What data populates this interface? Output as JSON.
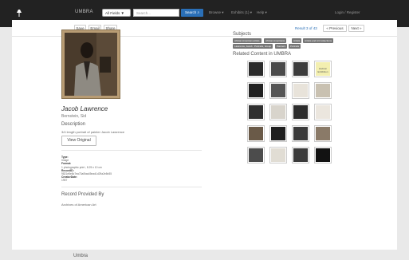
{
  "nav": {
    "brand": "UMBRA",
    "scope_select": "All Fields ▼",
    "search_placeholder": "Search...",
    "search_button": "Search",
    "browse": "Browse ▾",
    "exhibits": "Exhibits (1) ▾",
    "help": "Help ▾",
    "login": "Login / Register"
  },
  "toolbar": {
    "save": "Save",
    "email": "Email",
    "share": "Share",
    "result": "Result 3 of 43",
    "previous": "« Previous",
    "next": "Next »"
  },
  "item": {
    "title": "Jacob Lawrence",
    "creator": "Bernstein, Sid",
    "description_label": "Description",
    "description": "3/4 length portrait of painter Jacob Lawrence",
    "view_original": "View Original",
    "meta": [
      {
        "label": "Type:",
        "value": "Image"
      },
      {
        "label": "Format:",
        "value": "1 photographic print ; 8.25 x 10 cm"
      },
      {
        "label": "RecordID:",
        "value": "9821e5e8c7ea73a0faa45ead1d29a2e8e35"
      },
      {
        "label": "CreatorDate:",
        "value": "1957"
      }
    ],
    "provided_label": "Record Provided By",
    "provided_by": "Archives of American Art"
  },
  "subjects": {
    "label": "Subjects",
    "tags": [
      "African American artists",
      "African Americans",
      "Artists",
      "Artists and Art Collections",
      "Lawrence, Jacob",
      "Portraits, Group",
      "Painters",
      "Portraits"
    ]
  },
  "related": {
    "label": "Related Content in UMBRA",
    "thumbs": [
      {
        "tone": "#2b2b2b",
        "text": ""
      },
      {
        "tone": "#4a4a4a",
        "text": ""
      },
      {
        "tone": "#3c3c3c",
        "text": ""
      },
      {
        "tone": "#f3efb0",
        "text": "Hodson Exhibition"
      },
      {
        "tone": "#222222",
        "text": ""
      },
      {
        "tone": "#555555",
        "text": ""
      },
      {
        "tone": "#e8e3da",
        "text": ""
      },
      {
        "tone": "#c9c1b1",
        "text": ""
      },
      {
        "tone": "#2f2f2f",
        "text": ""
      },
      {
        "tone": "#d8d4cc",
        "text": ""
      },
      {
        "tone": "#2c2c2c",
        "text": ""
      },
      {
        "tone": "#ebe6de",
        "text": ""
      },
      {
        "tone": "#6a5a48",
        "text": ""
      },
      {
        "tone": "#1f1f1f",
        "text": ""
      },
      {
        "tone": "#3a3a3a",
        "text": ""
      },
      {
        "tone": "#8a7a68",
        "text": ""
      },
      {
        "tone": "#4c4c4c",
        "text": ""
      },
      {
        "tone": "#e1ddd4",
        "text": ""
      },
      {
        "tone": "#3b3b3b",
        "text": ""
      },
      {
        "tone": "#121212",
        "text": ""
      }
    ]
  },
  "footer": {
    "title": "Umbra"
  }
}
